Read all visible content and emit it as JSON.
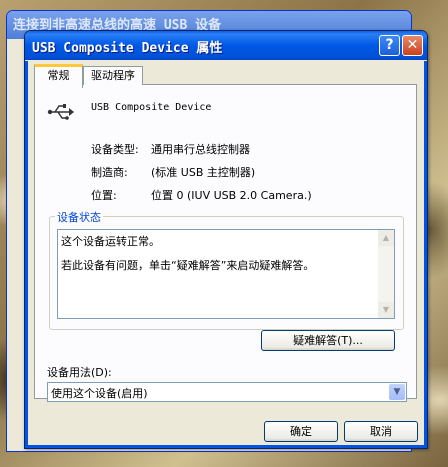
{
  "background_window": {
    "title": "连接到非高速总线的高速 USB 设备"
  },
  "dialog": {
    "title": "USB Composite Device 属性",
    "help_glyph": "?",
    "close_glyph": "✕",
    "tabs": [
      {
        "label": "常规"
      },
      {
        "label": "驱动程序"
      }
    ],
    "device_name": "USB Composite Device",
    "properties": [
      {
        "label": "设备类型:",
        "value": "通用串行总线控制器"
      },
      {
        "label": "制造商:",
        "value": "(标准 USB 主控制器)"
      },
      {
        "label": "位置:",
        "value": "位置 0 (IUV  USB 2.0 Camera.)"
      }
    ],
    "status": {
      "group_title": "设备状态",
      "line1": "这个设备运转正常。",
      "line2": "若此设备有问题，单击“疑难解答”来启动疑难解答。"
    },
    "troubleshoot_label": "疑难解答(T)...",
    "usage_label": "设备用法(D):",
    "usage_value": "使用这个设备(启用)",
    "ok_label": "确定",
    "cancel_label": "取消"
  },
  "icons": {
    "device": "usb-icon",
    "dropdown": "chevron-down-icon",
    "scroll_up": "arrow-up-icon",
    "scroll_down": "arrow-down-icon"
  },
  "colors": {
    "titlebar": "#0058e6",
    "close": "#c9411d",
    "group_title": "#0046d5",
    "dialog_bg": "#ece9d8"
  }
}
